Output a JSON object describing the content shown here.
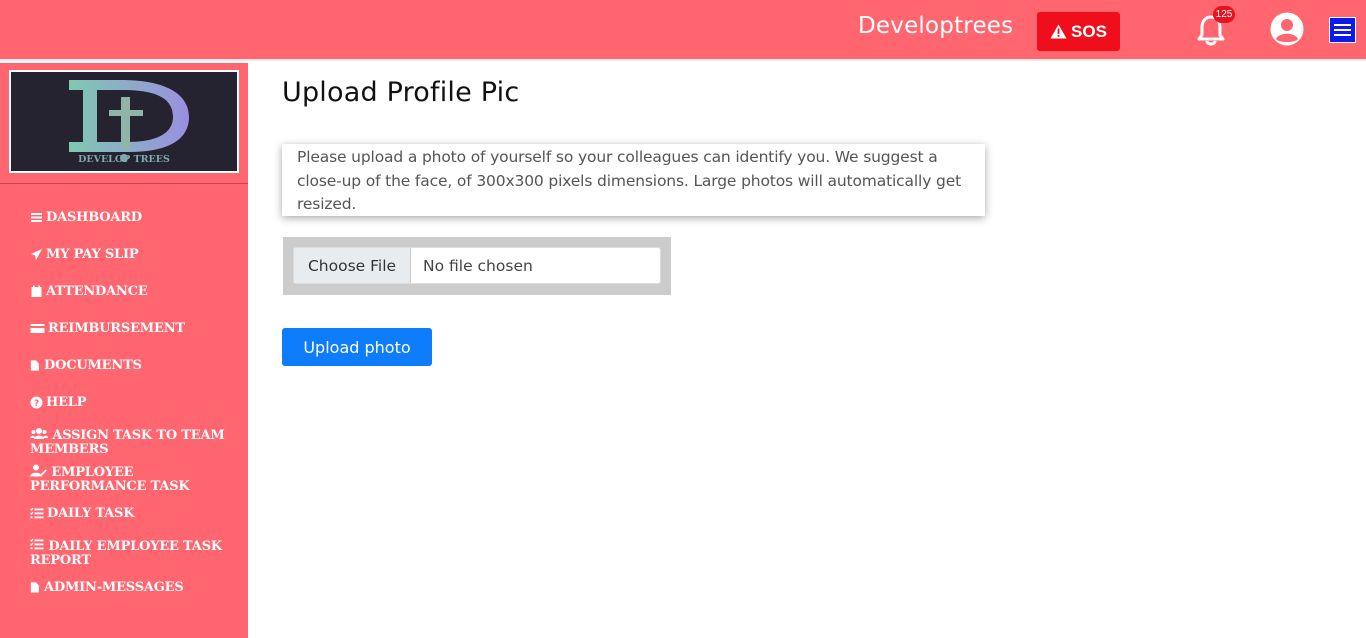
{
  "header": {
    "brand": "Developtrees",
    "sos_label": "SOS",
    "notification_count": "125"
  },
  "sidebar": {
    "logo_text": "DEVELOP TREES",
    "items": [
      {
        "label": "DASHBOARD",
        "icon": "bars-icon"
      },
      {
        "label": "MY PAY SLIP",
        "icon": "paper-plane-icon"
      },
      {
        "label": "ATTENDANCE",
        "icon": "calendar-icon"
      },
      {
        "label": "REIMBURSEMENT",
        "icon": "credit-card-icon"
      },
      {
        "label": "DOCUMENTS",
        "icon": "file-icon"
      },
      {
        "label": "HELP",
        "icon": "question-circle-icon"
      },
      {
        "label": "ASSIGN TASK TO TEAM MEMBERS",
        "icon": "users-icon"
      },
      {
        "label": "EMPLOYEE PERFORMANCE TASK",
        "icon": "user-edit-icon"
      },
      {
        "label": "DAILY TASK",
        "icon": "tasks-icon"
      },
      {
        "label": "DAILY EMPLOYEE TASK REPORT",
        "icon": "tasks-icon"
      },
      {
        "label": "ADMIN-MESSAGES",
        "icon": "file-icon"
      }
    ]
  },
  "main": {
    "title": "Upload Profile Pic",
    "notice": "Please upload a photo of yourself so your colleagues can identify you. We suggest a close-up of the face, of 300x300 pixels dimensions. Large photos will automatically get resized.",
    "file_button_label": "Choose File",
    "file_status": "No file chosen",
    "upload_button_label": "Upload photo"
  },
  "colors": {
    "topbar": "#ff6670",
    "sidebar": "#ff6670",
    "sos": "#f10e1c",
    "menu_button": "#0b1bef",
    "upload_button": "#0d7dfc"
  }
}
